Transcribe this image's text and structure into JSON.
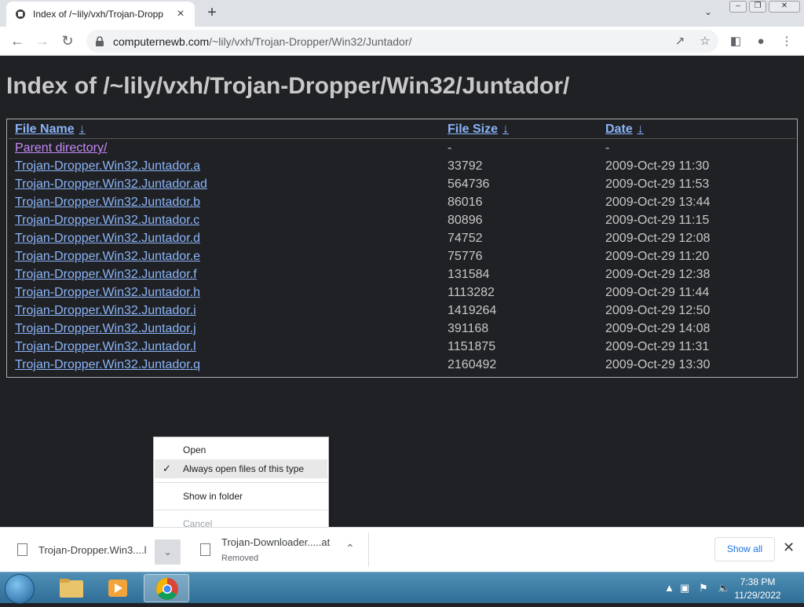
{
  "browser": {
    "tab_title": "Index of /~lily/vxh/Trojan-Dropp",
    "tab_close": "×",
    "new_tab": "+",
    "url_host": "computernewb.com",
    "url_path": "/~lily/vxh/Trojan-Dropper/Win32/Juntador/"
  },
  "page": {
    "heading": "Index of /~lily/vxh/Trojan-Dropper/Win32/Juntador/",
    "columns": {
      "name": "File Name",
      "size": "File Size",
      "date": "Date",
      "sort_arrow": "↓"
    },
    "rows": [
      {
        "name": "Parent directory/",
        "size": "-",
        "date": "-"
      },
      {
        "name": "Trojan-Dropper.Win32.Juntador.a",
        "size": "33792",
        "date": "2009-Oct-29 11:30"
      },
      {
        "name": "Trojan-Dropper.Win32.Juntador.ad",
        "size": "564736",
        "date": "2009-Oct-29 11:53"
      },
      {
        "name": "Trojan-Dropper.Win32.Juntador.b",
        "size": "86016",
        "date": "2009-Oct-29 13:44"
      },
      {
        "name": "Trojan-Dropper.Win32.Juntador.c",
        "size": "80896",
        "date": "2009-Oct-29 11:15"
      },
      {
        "name": "Trojan-Dropper.Win32.Juntador.d",
        "size": "74752",
        "date": "2009-Oct-29 12:08"
      },
      {
        "name": "Trojan-Dropper.Win32.Juntador.e",
        "size": "75776",
        "date": "2009-Oct-29 11:20"
      },
      {
        "name": "Trojan-Dropper.Win32.Juntador.f",
        "size": "131584",
        "date": "2009-Oct-29 12:38"
      },
      {
        "name": "Trojan-Dropper.Win32.Juntador.h",
        "size": "1113282",
        "date": "2009-Oct-29 11:44"
      },
      {
        "name": "Trojan-Dropper.Win32.Juntador.i",
        "size": "1419264",
        "date": "2009-Oct-29 12:50"
      },
      {
        "name": "Trojan-Dropper.Win32.Juntador.j",
        "size": "391168",
        "date": "2009-Oct-29 14:08"
      },
      {
        "name": "Trojan-Dropper.Win32.Juntador.l",
        "size": "1151875",
        "date": "2009-Oct-29 11:31"
      },
      {
        "name": "Trojan-Dropper.Win32.Juntador.q",
        "size": "2160492",
        "date": "2009-Oct-29 13:30"
      }
    ]
  },
  "context_menu": {
    "items": [
      {
        "label": "Open",
        "checked": false,
        "disabled": false
      },
      {
        "label": "Always open files of this type",
        "checked": true,
        "disabled": false,
        "highlighted": true
      },
      {
        "label": "Show in folder",
        "checked": false,
        "disabled": false
      },
      {
        "label": "Cancel",
        "checked": false,
        "disabled": true
      }
    ]
  },
  "downloads": {
    "items": [
      {
        "name": "Trojan-Dropper.Win3....l",
        "status": ""
      },
      {
        "name": "Trojan-Downloader.....at",
        "status": "Removed"
      }
    ],
    "show_all": "Show all",
    "close": "✕"
  },
  "taskbar": {
    "time": "7:38 PM",
    "date": "11/29/2022"
  }
}
